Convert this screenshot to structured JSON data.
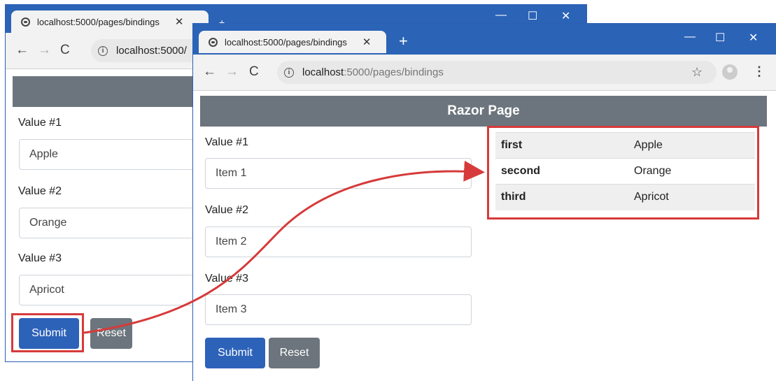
{
  "colors": {
    "titlebar": "#2b63b6",
    "header": "#6c757d",
    "primary": "#2d62b9",
    "secondary": "#6c757d",
    "highlight": "#d63a3a"
  },
  "back_window": {
    "tab_title": "localhost:5000/pages/bindings",
    "tab_close": "✕",
    "address": "localhost:5000/",
    "fields": [
      {
        "label": "Value #1",
        "value": "Apple"
      },
      {
        "label": "Value #2",
        "value": "Orange"
      },
      {
        "label": "Value #3",
        "value": "Apricot"
      }
    ],
    "submit_label": "Submit",
    "reset_label": "Reset"
  },
  "front_window": {
    "tab_title": "localhost:5000/pages/bindings",
    "tab_close": "✕",
    "new_tab": "+",
    "address_host": "localhost",
    "address_rest": ":5000/pages/bindings",
    "header": "Razor Page",
    "fields": [
      {
        "label": "Value #1",
        "value": "Item 1"
      },
      {
        "label": "Value #2",
        "value": "Item 2"
      },
      {
        "label": "Value #3",
        "value": "Item 3"
      }
    ],
    "submit_label": "Submit",
    "reset_label": "Reset",
    "results": [
      {
        "key": "first",
        "value": "Apple"
      },
      {
        "key": "second",
        "value": "Orange"
      },
      {
        "key": "third",
        "value": "Apricot"
      }
    ]
  },
  "window_controls": {
    "minimize": "—",
    "maximize": "☐",
    "close": "✕"
  },
  "icons": {
    "back": "arrow-left-icon",
    "forward": "arrow-right-icon",
    "reload": "reload-icon",
    "info": "info-icon",
    "star": "star-icon",
    "profile": "profile-icon",
    "menu": "kebab-menu-icon"
  }
}
